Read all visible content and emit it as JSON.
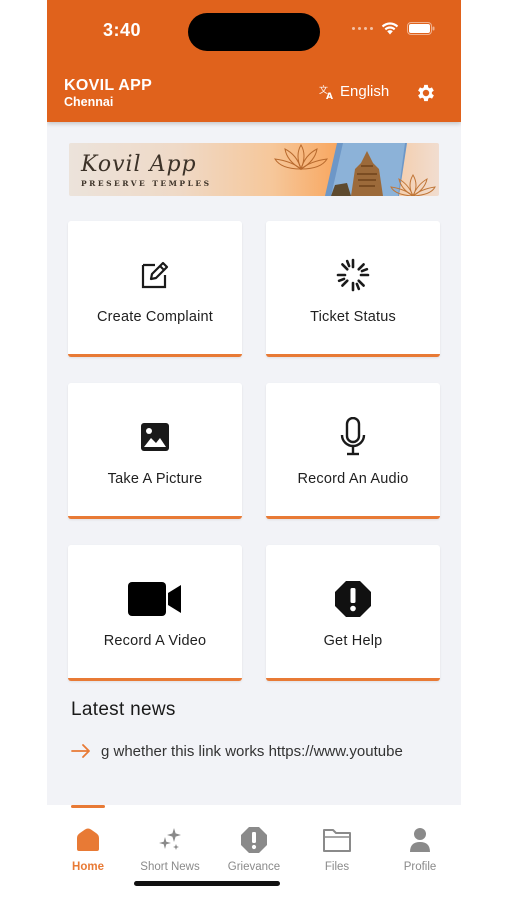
{
  "status_bar": {
    "time": "3:40"
  },
  "header": {
    "app_name": "KOVIL APP",
    "city": "Chennai",
    "language": "English",
    "bg_color": "#e0621c"
  },
  "banner": {
    "title": "Kovil App",
    "subtitle": "PRESERVE TEMPLES"
  },
  "actions": [
    {
      "label": "Create Complaint",
      "icon": "edit-icon"
    },
    {
      "label": "Ticket Status",
      "icon": "loading-spinner-icon"
    },
    {
      "label": "Take A Picture",
      "icon": "image-icon"
    },
    {
      "label": "Record An Audio",
      "icon": "microphone-icon"
    },
    {
      "label": "Record A Video",
      "icon": "video-camera-icon"
    },
    {
      "label": "Get Help",
      "icon": "alert-octagon-icon"
    }
  ],
  "news": {
    "title": "Latest news",
    "items": [
      "g whether this link works https://www.youtube"
    ]
  },
  "tabs": [
    {
      "label": "Home",
      "icon": "home-icon",
      "active": true
    },
    {
      "label": "Short News",
      "icon": "sparkles-icon",
      "active": false
    },
    {
      "label": "Grievance",
      "icon": "alert-icon",
      "active": false
    },
    {
      "label": "Files",
      "icon": "folder-icon",
      "active": false
    },
    {
      "label": "Profile",
      "icon": "person-icon",
      "active": false
    }
  ],
  "accent_color": "#e87a35"
}
